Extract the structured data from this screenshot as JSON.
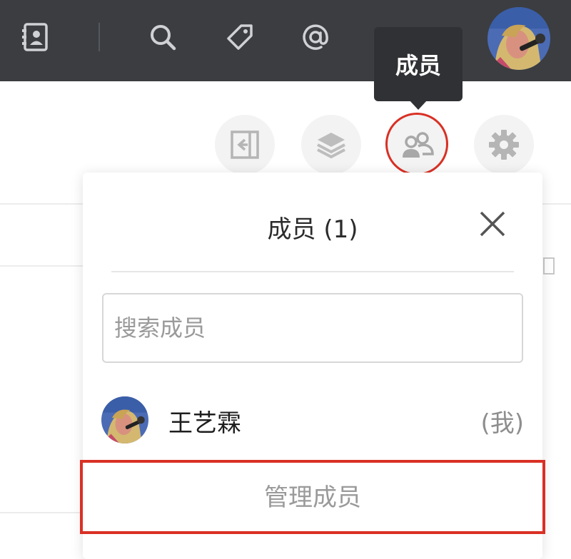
{
  "topbar": {
    "icons": [
      "contacts-icon",
      "search-icon",
      "tag-icon",
      "at-icon",
      "avatar"
    ]
  },
  "tooltip": {
    "label": "成员"
  },
  "toolbar": {
    "buttons": [
      "collapse-panel-icon",
      "layers-icon",
      "members-icon",
      "settings-icon"
    ]
  },
  "panel": {
    "title": "成员 (1)",
    "search_placeholder": "搜索成员",
    "members": [
      {
        "name": "王艺霖",
        "tag": "(我)"
      }
    ],
    "manage_label": "管理成员"
  },
  "colors": {
    "topbar_bg": "#3b3d40",
    "highlight": "#d93025"
  }
}
